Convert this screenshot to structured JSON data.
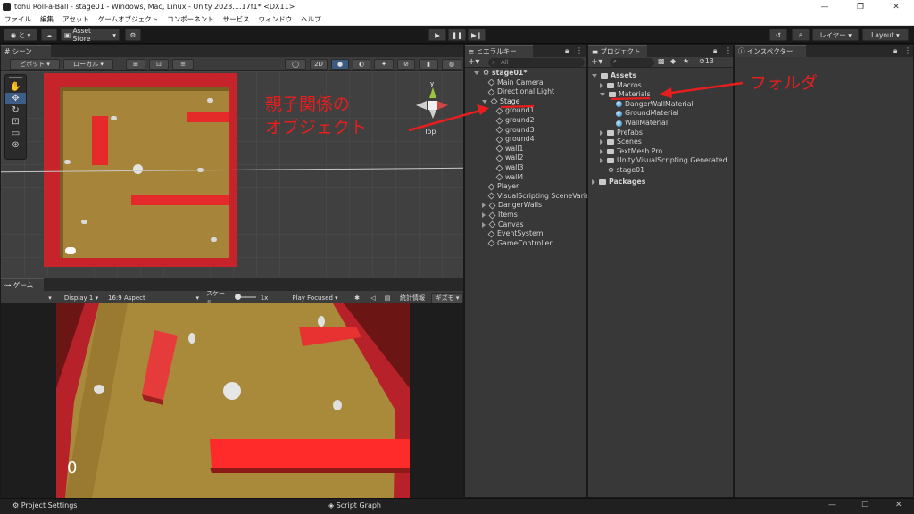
{
  "window": {
    "title": "tohu Roll-a-Ball - stage01 - Windows, Mac, Linux - Unity 2023.1.17f1* <DX11>",
    "minimize": "—",
    "maximize": "❐",
    "close": "✕"
  },
  "menu": [
    "ファイル",
    "編集",
    "アセット",
    "ゲームオブジェクト",
    "コンポーネント",
    "サービス",
    "ウィンドウ",
    "ヘルプ"
  ],
  "toolbar": {
    "account": "と",
    "asset_store": "Asset Store",
    "layers": "レイヤー",
    "layout": "Layout"
  },
  "scene": {
    "tab": "シーン",
    "pivot": "ピボット",
    "local": "ローカル",
    "mode_2d": "2D",
    "gizmo_label": "Top"
  },
  "game": {
    "tab": "ゲーム",
    "display": "Display 1",
    "aspect": "16:9 Aspect",
    "scale_label": "スケール",
    "scale_value": "1x",
    "play_mode": "Play Focused",
    "stats": "統計情報",
    "gizmos": "ギズモ",
    "score": "0"
  },
  "hierarchy": {
    "tab": "ヒエラルキー",
    "search_placeholder": "All",
    "items": [
      {
        "label": "stage01*",
        "depth": 0,
        "kind": "scene"
      },
      {
        "label": "Main Camera",
        "depth": 1,
        "kind": "go"
      },
      {
        "label": "Directional Light",
        "depth": 1,
        "kind": "go"
      },
      {
        "label": "Stage",
        "depth": 1,
        "kind": "go-expanded"
      },
      {
        "label": "ground1",
        "depth": 2,
        "kind": "go"
      },
      {
        "label": "ground2",
        "depth": 2,
        "kind": "go"
      },
      {
        "label": "ground3",
        "depth": 2,
        "kind": "go"
      },
      {
        "label": "ground4",
        "depth": 2,
        "kind": "go"
      },
      {
        "label": "wall1",
        "depth": 2,
        "kind": "go"
      },
      {
        "label": "wall2",
        "depth": 2,
        "kind": "go"
      },
      {
        "label": "wall3",
        "depth": 2,
        "kind": "go"
      },
      {
        "label": "wall4",
        "depth": 2,
        "kind": "go"
      },
      {
        "label": "Player",
        "depth": 1,
        "kind": "go"
      },
      {
        "label": "VisualScripting SceneVariables",
        "depth": 1,
        "kind": "go"
      },
      {
        "label": "DangerWalls",
        "depth": 1,
        "kind": "go-collapsed"
      },
      {
        "label": "Items",
        "depth": 1,
        "kind": "go-collapsed"
      },
      {
        "label": "Canvas",
        "depth": 1,
        "kind": "go-collapsed"
      },
      {
        "label": "EventSystem",
        "depth": 1,
        "kind": "go"
      },
      {
        "label": "GameController",
        "depth": 1,
        "kind": "go"
      }
    ]
  },
  "project": {
    "tab": "プロジェクト",
    "hidden_count": "13",
    "items": [
      {
        "label": "Assets",
        "depth": 0,
        "kind": "folder-open",
        "bold": true
      },
      {
        "label": "Macros",
        "depth": 1,
        "kind": "folder"
      },
      {
        "label": "Materials",
        "depth": 1,
        "kind": "folder-open"
      },
      {
        "label": "DangerWallMaterial",
        "depth": 2,
        "kind": "mat"
      },
      {
        "label": "GroundMaterial",
        "depth": 2,
        "kind": "mat"
      },
      {
        "label": "WallMaterial",
        "depth": 2,
        "kind": "mat"
      },
      {
        "label": "Prefabs",
        "depth": 1,
        "kind": "folder"
      },
      {
        "label": "Scenes",
        "depth": 1,
        "kind": "folder"
      },
      {
        "label": "TextMesh Pro",
        "depth": 1,
        "kind": "folder"
      },
      {
        "label": "Unity.VisualScripting.Generated",
        "depth": 1,
        "kind": "folder"
      },
      {
        "label": "stage01",
        "depth": 1,
        "kind": "scene"
      },
      {
        "label": "Packages",
        "depth": 0,
        "kind": "folder",
        "bold": true
      }
    ]
  },
  "inspector": {
    "tab": "インスペクター"
  },
  "annotations": {
    "parent_child": "親子関係の\nオブジェクト",
    "folder": "フォルダ",
    "accent": "#e61e1e"
  },
  "bottom": {
    "project_settings": "Project Settings",
    "script_graph": "Script Graph"
  }
}
